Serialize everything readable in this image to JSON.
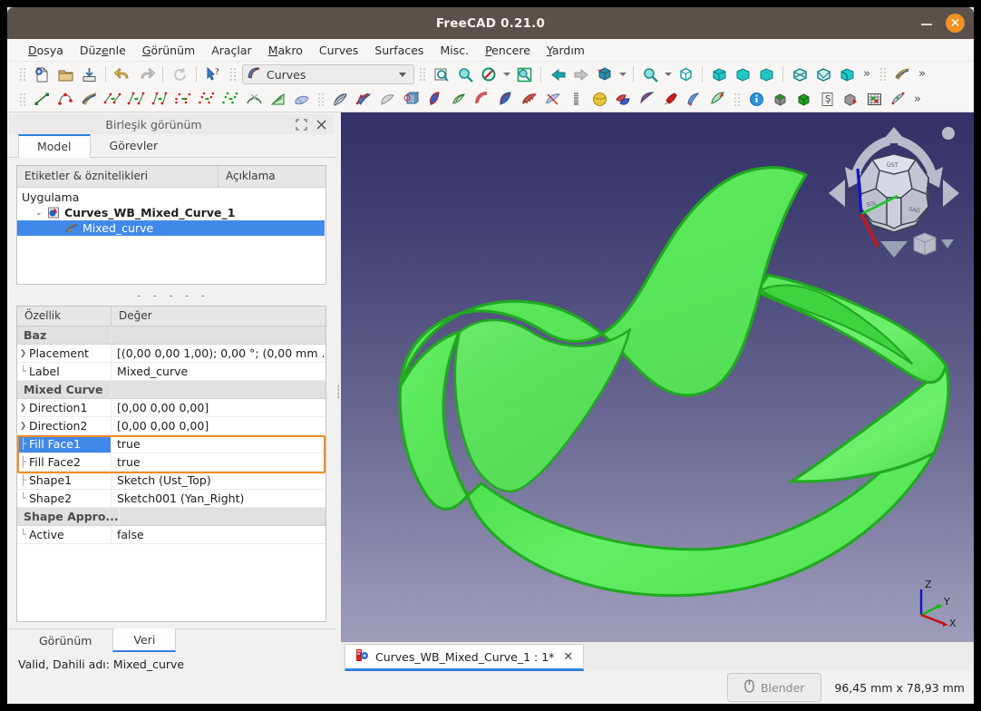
{
  "window": {
    "title": "FreeCAD 0.21.0",
    "minimize_label": "Küçült",
    "close_label": "Kapat",
    "accent": "#2f7fe0",
    "close_color": "#f0921f",
    "titlebar_color": "#5a514d"
  },
  "menubar": [
    {
      "label": "Dosya",
      "mnemonic": "D"
    },
    {
      "label": "Düzenle",
      "mnemonic": "e"
    },
    {
      "label": "Görünüm",
      "mnemonic": "G"
    },
    {
      "label": "Araçlar",
      "mnemonic": ""
    },
    {
      "label": "Makro",
      "mnemonic": "M"
    },
    {
      "label": "Curves",
      "mnemonic": ""
    },
    {
      "label": "Surfaces",
      "mnemonic": ""
    },
    {
      "label": "Misc.",
      "mnemonic": ""
    },
    {
      "label": "Pencere",
      "mnemonic": "P"
    },
    {
      "label": "Yardım",
      "mnemonic": "Y"
    }
  ],
  "toolbar": {
    "workbench_selected": "Curves",
    "overflow_label": "»",
    "row1_icons": [
      "new-document-icon",
      "open-folder-icon",
      "save-icon",
      "undo-icon",
      "redo-icon",
      "refresh-icon",
      "whats-this-icon"
    ],
    "row1b_icons": [
      "std-view-fit-icon",
      "zoom-icon",
      "std-view-box-selection-icon",
      "draw-style-icon"
    ],
    "row1c_icons": [
      "back-arrow-icon",
      "forward-arrow-icon",
      "std-view-isometric-icon",
      "zoom-fit-icon",
      "axonometric-icon",
      "view-front-icon",
      "view-top-icon",
      "view-right-icon",
      "view-rear-icon",
      "view-bottom-icon",
      "view-left-icon"
    ],
    "row2_icons": [
      "line-icon",
      "bspline-icon",
      "mixed-curve-icon",
      "join-curve-icon",
      "split-curve-icon",
      "discretize-icon",
      "approximate-icon",
      "interpolate-icon",
      "parametric-blend-icon",
      "blend-curve-icon",
      "comb-plot-icon",
      "zebra-icon"
    ],
    "row2b_icons": [
      "isocurve-icon",
      "sketch-on-surface-icon",
      "flatten-face-icon",
      "profile-support-icon",
      "gordon-surface-icon",
      "sweep2rails-icon",
      "pipeshell-icon",
      "curve-on-surface-icon",
      "segment-surface-icon",
      "surface-deviation-icon",
      "spring-icon",
      "sphere-icon"
    ],
    "row2c_icons": [
      "solid-icon",
      "nurbs-surface-icon",
      "bezier-surface-icon",
      "paint-icon",
      "half-pipe-icon",
      "info-icon",
      "box-gray-icon",
      "box-green-icon",
      "macro-icon",
      "box-red-arrow-icon",
      "grid-icon",
      "toponaming-icon"
    ]
  },
  "left_panel": {
    "panel_title": "Birleşik görünüm",
    "restore_label": "Geri yükle",
    "close_label": "Kapat",
    "tabs": [
      {
        "label": "Model",
        "active": true
      },
      {
        "label": "Görevler",
        "active": false
      }
    ],
    "tree": {
      "headers": [
        "Etiketler & öznitelikleri",
        "Açıklama"
      ],
      "items": [
        {
          "label": "Uygulama",
          "level": 1,
          "icon": "",
          "arrow": "",
          "selected": false,
          "bold": false
        },
        {
          "label": "Curves_WB_Mixed_Curve_1",
          "level": 2,
          "icon": "document-icon",
          "arrow": "⌄",
          "selected": false,
          "bold": true
        },
        {
          "label": "Mixed_curve",
          "level": 3,
          "icon": "mixed-curve-icon",
          "arrow": "›",
          "selected": true,
          "bold": false
        }
      ]
    },
    "separator": "- - - - -",
    "properties": {
      "headers": [
        "Özellik",
        "Değer"
      ],
      "rows": [
        {
          "type": "group",
          "name": "Baz",
          "value": ""
        },
        {
          "type": "item",
          "name": "Placement",
          "value": "[(0,00 0,00 1,00); 0,00 °; (0,00 mm  ...",
          "expandable": true,
          "selected": false,
          "highlight": false
        },
        {
          "type": "item",
          "name": "Label",
          "value": "Mixed_curve",
          "expandable": false,
          "selected": false,
          "highlight": false
        },
        {
          "type": "group",
          "name": "Mixed Curve",
          "value": ""
        },
        {
          "type": "item",
          "name": "Direction1",
          "value": "[0,00 0,00 0,00]",
          "expandable": true,
          "selected": false,
          "highlight": false
        },
        {
          "type": "item",
          "name": "Direction2",
          "value": "[0,00 0,00 0,00]",
          "expandable": true,
          "selected": false,
          "highlight": false
        },
        {
          "type": "item",
          "name": "Fill Face1",
          "value": "true",
          "expandable": false,
          "selected": true,
          "highlight": true
        },
        {
          "type": "item",
          "name": "Fill Face2",
          "value": "true",
          "expandable": false,
          "selected": false,
          "highlight": true
        },
        {
          "type": "item",
          "name": "Shape1",
          "value": "Sketch (Ust_Top)",
          "expandable": false,
          "selected": false,
          "highlight": false
        },
        {
          "type": "item",
          "name": "Shape2",
          "value": "Sketch001 (Yan_Right)",
          "expandable": false,
          "selected": false,
          "highlight": false
        },
        {
          "type": "group",
          "name": "Shape Appro...",
          "value": ""
        },
        {
          "type": "item",
          "name": "Active",
          "value": "false",
          "expandable": false,
          "selected": false,
          "highlight": false
        }
      ]
    },
    "bottom_tabs": [
      {
        "label": "Görünüm",
        "active": false
      },
      {
        "label": "Veri",
        "active": true
      }
    ],
    "status_text": "Valid, Dahili adı: Mixed_curve"
  },
  "viewport": {
    "background_top": "#333167",
    "background_bottom": "#9d9cbb",
    "shape_color": "#5ce85c",
    "shape_edge_color": "#22a822",
    "navcube_label": "navigation-cube",
    "axis_labels": [
      "Z",
      "Y",
      "X"
    ],
    "axis_colors": {
      "x": "#cc1111",
      "y": "#11bb11",
      "z": "#1111cc"
    }
  },
  "doc_tabs": [
    {
      "label": "Curves_WB_Mixed_Curve_1 : 1*",
      "close": "✕",
      "active": true
    }
  ],
  "bottom_bar": {
    "blender_button": "Blender",
    "blender_icon": "mouse-icon",
    "dimensions": "96,45 mm x 78,93 mm"
  }
}
